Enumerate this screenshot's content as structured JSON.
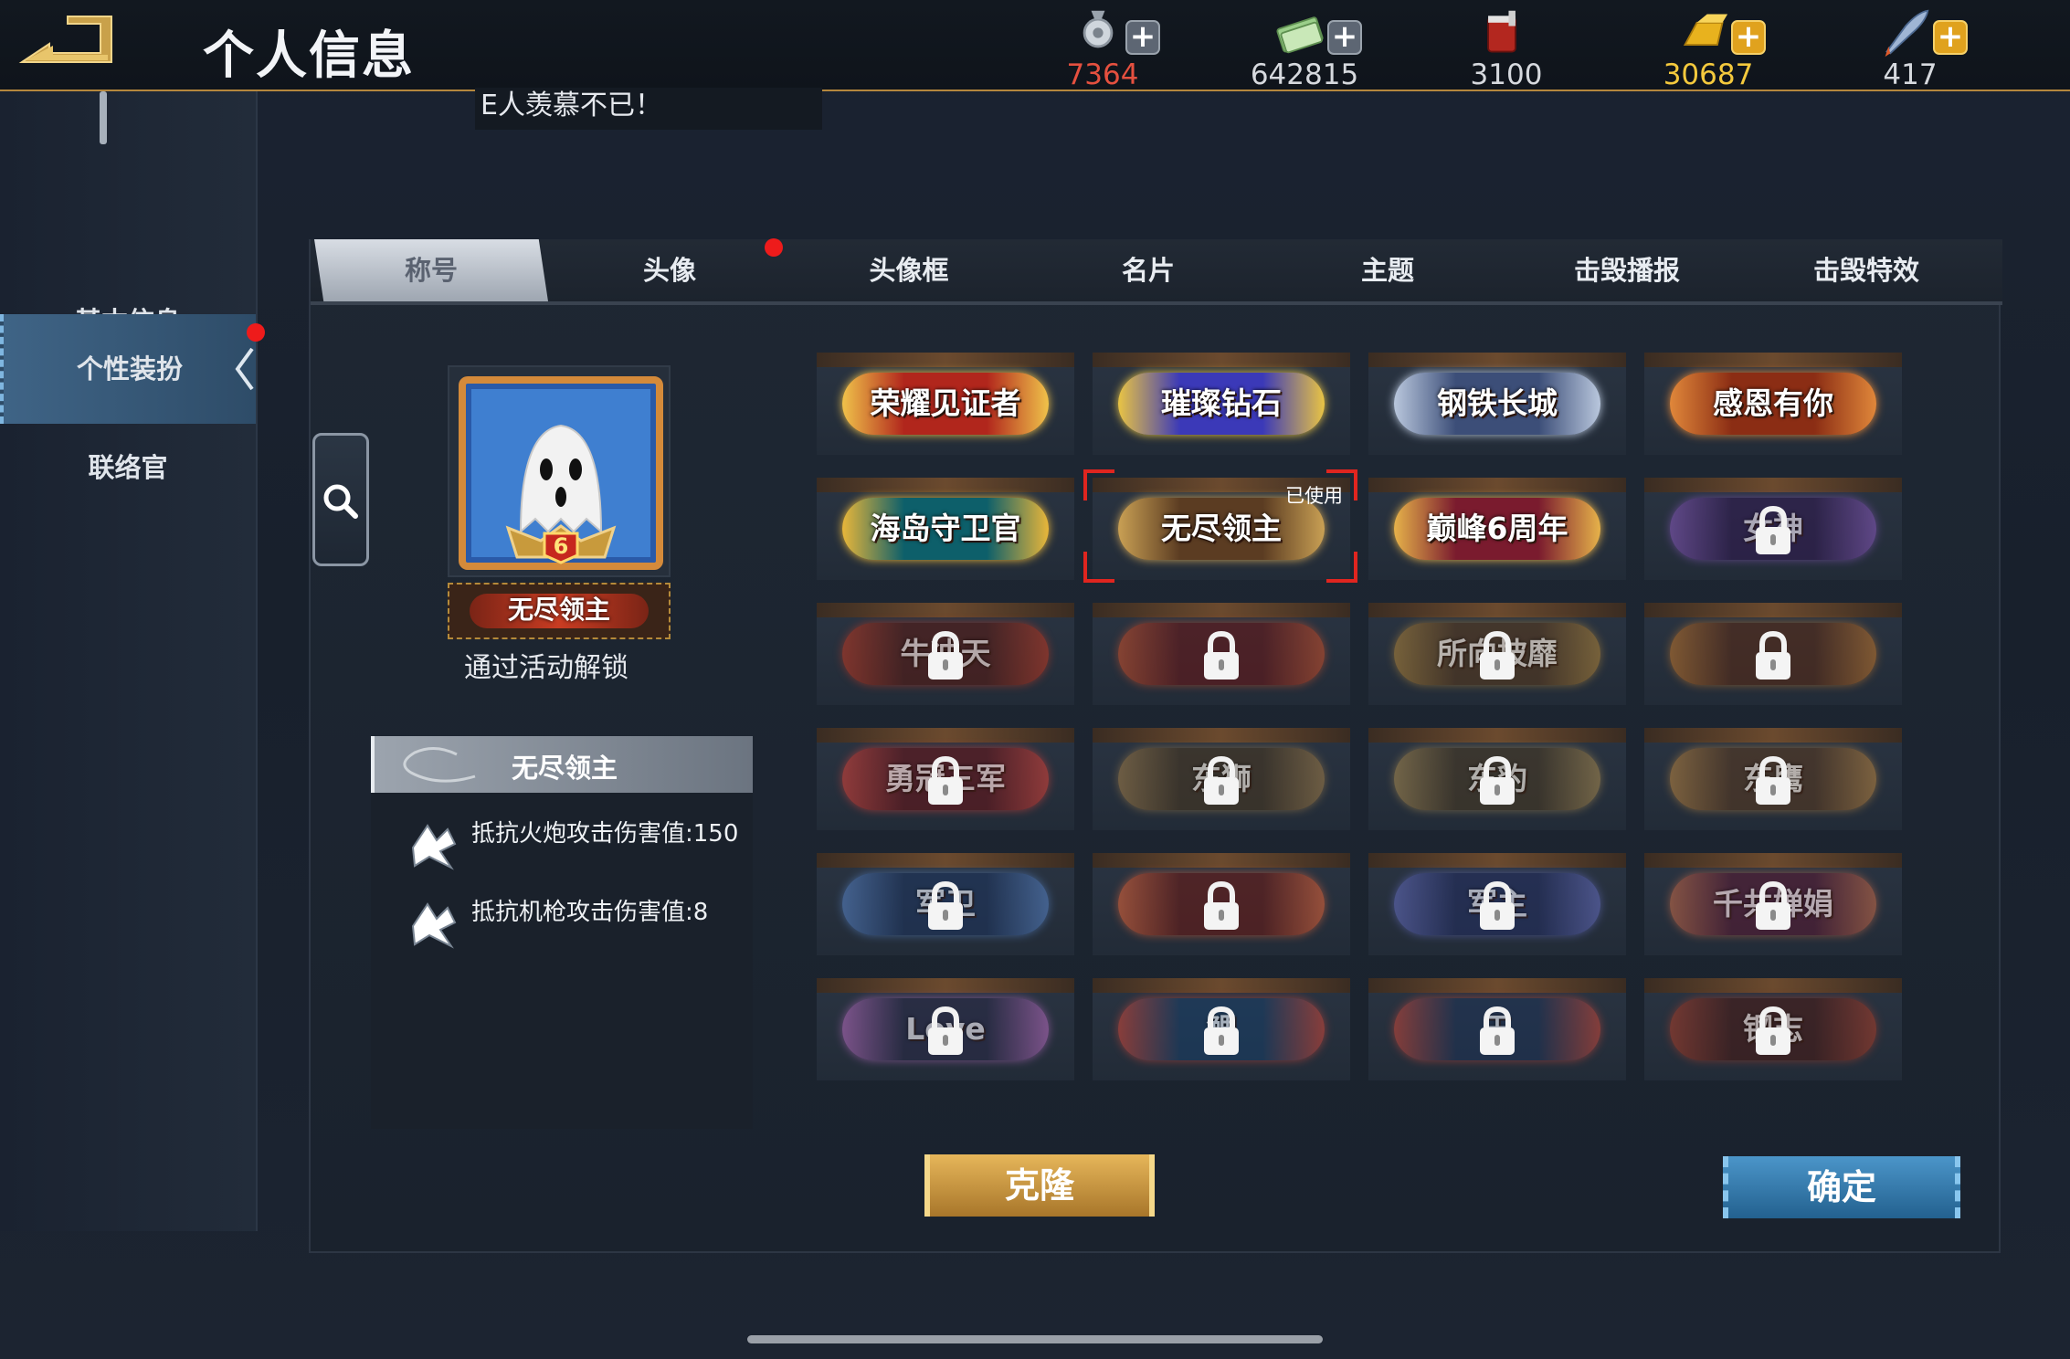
{
  "header": {
    "title": "个人信息"
  },
  "resources": [
    {
      "name": "medal-icon",
      "value": "7364",
      "color": "#e5503f",
      "has_plus": true
    },
    {
      "name": "cash-icon",
      "value": "642815",
      "color": "#d6d9de",
      "has_plus": true
    },
    {
      "name": "paint-bucket-icon",
      "value": "3100",
      "color": "#d6d9de",
      "has_plus": false
    },
    {
      "name": "gold-bar-icon",
      "value": "30687",
      "color": "#f4c93d",
      "has_plus": true
    },
    {
      "name": "rocket-icon",
      "value": "417",
      "color": "#d6d9de",
      "has_plus": true
    }
  ],
  "marquee": {
    "text": "E人羡慕不已！"
  },
  "sidebar": {
    "items": [
      {
        "label": "基本信息",
        "active": false
      },
      {
        "label": "个性装扮",
        "active": true
      },
      {
        "label": "联络官",
        "active": false
      }
    ]
  },
  "tabs": [
    {
      "label": "称号",
      "active": true
    },
    {
      "label": "头像",
      "active": false
    },
    {
      "label": "头像框",
      "active": false
    },
    {
      "label": "名片",
      "active": false
    },
    {
      "label": "主题",
      "active": false
    },
    {
      "label": "击毁播报",
      "active": false
    },
    {
      "label": "击毁特效",
      "active": false
    }
  ],
  "preview": {
    "title_badge": "无尽领主",
    "caption": "通过活动解锁",
    "avatar_level": "6"
  },
  "detail": {
    "title": "无尽领主",
    "attributes": [
      "抵抗火炮攻击伤害值:150",
      "抵抗机枪攻击伤害值:8"
    ]
  },
  "titles": [
    {
      "label": "荣耀见证者",
      "locked": false,
      "colors": [
        "#b1261c",
        "#f0c24a"
      ]
    },
    {
      "label": "璀璨钻石",
      "locked": false,
      "colors": [
        "#3b39b8",
        "#e9c444"
      ]
    },
    {
      "label": "钢铁长城",
      "locked": false,
      "colors": [
        "#3c4e78",
        "#b9c7dd"
      ]
    },
    {
      "label": "感恩有你",
      "locked": false,
      "colors": [
        "#8b2d14",
        "#e0873a"
      ]
    },
    {
      "label": "海岛守卫官",
      "locked": false,
      "colors": [
        "#0d5f6a",
        "#e8b63a"
      ]
    },
    {
      "label": "无尽领主",
      "locked": false,
      "used": true,
      "colors": [
        "#5b3c22",
        "#c9a054"
      ]
    },
    {
      "label": "巅峰6周年",
      "locked": false,
      "colors": [
        "#7a1b2e",
        "#e6b24a"
      ]
    },
    {
      "label": "女神",
      "locked": true,
      "colors": [
        "#321a52",
        "#8e5cc4"
      ]
    },
    {
      "label": "牛冲天",
      "locked": true,
      "colors": [
        "#5a1a12",
        "#c73b22"
      ]
    },
    {
      "label": "",
      "locked": true,
      "colors": [
        "#6a1616",
        "#d2532b"
      ]
    },
    {
      "label": "所向披靡",
      "locked": true,
      "colors": [
        "#5a3a1c",
        "#b88a3a"
      ]
    },
    {
      "label": "",
      "locked": true,
      "colors": [
        "#5a2a14",
        "#c77a2c"
      ]
    },
    {
      "label": "勇冠三军",
      "locked": true,
      "colors": [
        "#6a1418",
        "#e5453a"
      ]
    },
    {
      "label": "东狮",
      "locked": true,
      "colors": [
        "#4a3820",
        "#a7824a"
      ]
    },
    {
      "label": "东豹",
      "locked": true,
      "colors": [
        "#4a3a22",
        "#b09052"
      ]
    },
    {
      "label": "东鹰",
      "locked": true,
      "colors": [
        "#5a3a20",
        "#c18a42"
      ]
    },
    {
      "label": "军卫",
      "locked": true,
      "colors": [
        "#1d3560",
        "#5c8ad0"
      ]
    },
    {
      "label": "",
      "locked": true,
      "colors": [
        "#6e1a14",
        "#f06a3a"
      ]
    },
    {
      "label": "军主",
      "locked": true,
      "colors": [
        "#232e62",
        "#6a72c8"
      ]
    },
    {
      "label": "千共婵娟",
      "locked": true,
      "colors": [
        "#5a1a34",
        "#d0704a"
      ]
    },
    {
      "label": "Love",
      "locked": true,
      "colors": [
        "#2a2a48",
        "#c070c8"
      ]
    },
    {
      "label": "鲤",
      "locked": true,
      "colors": [
        "#18406a",
        "#d84a3a"
      ]
    },
    {
      "label": "王",
      "locked": true,
      "colors": [
        "#1e3458",
        "#d04a3a"
      ]
    },
    {
      "label": "钢志",
      "locked": true,
      "colors": [
        "#4a1a14",
        "#b0402a"
      ]
    }
  ],
  "buttons": {
    "clone": "克隆",
    "confirm": "确定"
  }
}
